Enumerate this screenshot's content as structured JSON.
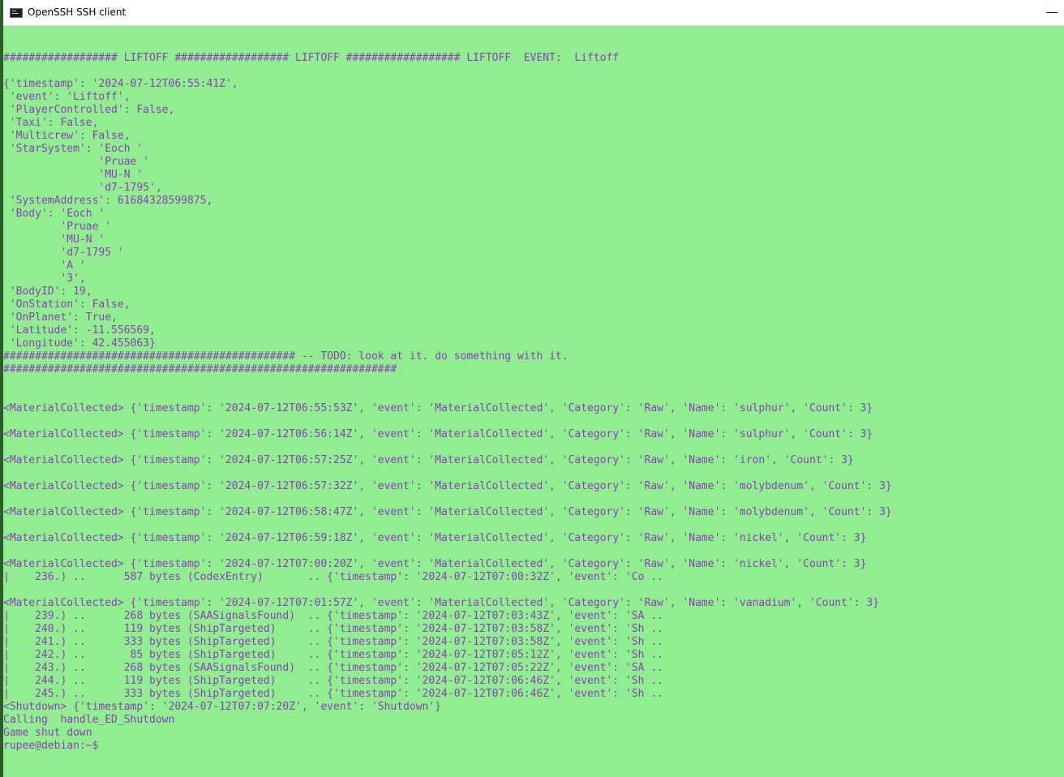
{
  "window": {
    "title": "OpenSSH SSH client",
    "icon": "console-icon",
    "minimize_icon": "minimize-icon"
  },
  "terminal": {
    "colors": {
      "background": "#90ee90",
      "text": "#8b3fb8"
    },
    "lines": [
      "",
      "",
      "################## LIFTOFF ################## LIFTOFF ################## LIFTOFF  EVENT:  Liftoff",
      "",
      "{'timestamp': '2024-07-12T06:55:41Z',",
      " 'event': 'Liftoff',",
      " 'PlayerControlled': False,",
      " 'Taxi': False,",
      " 'Multicrew': False,",
      " 'StarSystem': 'Eoch '",
      "               'Pruae '",
      "               'MU-N '",
      "               'd7-1795',",
      " 'SystemAddress': 61684328599875,",
      " 'Body': 'Eoch '",
      "         'Pruae '",
      "         'MU-N '",
      "         'd7-1795 '",
      "         'A '",
      "         '3',",
      " 'BodyID': 19,",
      " 'OnStation': False,",
      " 'OnPlanet': True,",
      " 'Latitude': -11.556569,",
      " 'Longitude': 42.455063}",
      "############################################## -- TODO: look at it. do something with it.",
      "##############################################################",
      "",
      "",
      "<MaterialCollected> {'timestamp': '2024-07-12T06:55:53Z', 'event': 'MaterialCollected', 'Category': 'Raw', 'Name': 'sulphur', 'Count': 3}",
      "",
      "<MaterialCollected> {'timestamp': '2024-07-12T06:56:14Z', 'event': 'MaterialCollected', 'Category': 'Raw', 'Name': 'sulphur', 'Count': 3}",
      "",
      "<MaterialCollected> {'timestamp': '2024-07-12T06:57:25Z', 'event': 'MaterialCollected', 'Category': 'Raw', 'Name': 'iron', 'Count': 3}",
      "",
      "<MaterialCollected> {'timestamp': '2024-07-12T06:57:32Z', 'event': 'MaterialCollected', 'Category': 'Raw', 'Name': 'molybdenum', 'Count': 3}",
      "",
      "<MaterialCollected> {'timestamp': '2024-07-12T06:58:47Z', 'event': 'MaterialCollected', 'Category': 'Raw', 'Name': 'molybdenum', 'Count': 3}",
      "",
      "<MaterialCollected> {'timestamp': '2024-07-12T06:59:18Z', 'event': 'MaterialCollected', 'Category': 'Raw', 'Name': 'nickel', 'Count': 3}",
      "",
      "<MaterialCollected> {'timestamp': '2024-07-12T07:00:20Z', 'event': 'MaterialCollected', 'Category': 'Raw', 'Name': 'nickel', 'Count': 3}",
      "|    236.) ..      587 bytes (CodexEntry)       .. {'timestamp': '2024-07-12T07:00:32Z', 'event': 'Co ..",
      "",
      "<MaterialCollected> {'timestamp': '2024-07-12T07:01:57Z', 'event': 'MaterialCollected', 'Category': 'Raw', 'Name': 'vanadium', 'Count': 3}",
      "|    239.) ..      268 bytes (SAASignalsFound)  .. {'timestamp': '2024-07-12T07:03:43Z', 'event': 'SA ..",
      "|    240.) ..      119 bytes (ShipTargeted)     .. {'timestamp': '2024-07-12T07:03:58Z', 'event': 'Sh ..",
      "|    241.) ..      333 bytes (ShipTargeted)     .. {'timestamp': '2024-07-12T07:03:58Z', 'event': 'Sh ..",
      "|    242.) ..       85 bytes (ShipTargeted)     .. {'timestamp': '2024-07-12T07:05:12Z', 'event': 'Sh ..",
      "|    243.) ..      268 bytes (SAASignalsFound)  .. {'timestamp': '2024-07-12T07:05:22Z', 'event': 'SA ..",
      "|    244.) ..      119 bytes (ShipTargeted)     .. {'timestamp': '2024-07-12T07:06:46Z', 'event': 'Sh ..",
      "|    245.) ..      333 bytes (ShipTargeted)     .. {'timestamp': '2024-07-12T07:06:46Z', 'event': 'Sh ..",
      "<Shutdown> {'timestamp': '2024-07-12T07:07:20Z', 'event': 'Shutdown'}",
      "Calling  handle_ED_Shutdown",
      "Game shut down",
      "rupee@debian:~$"
    ]
  }
}
